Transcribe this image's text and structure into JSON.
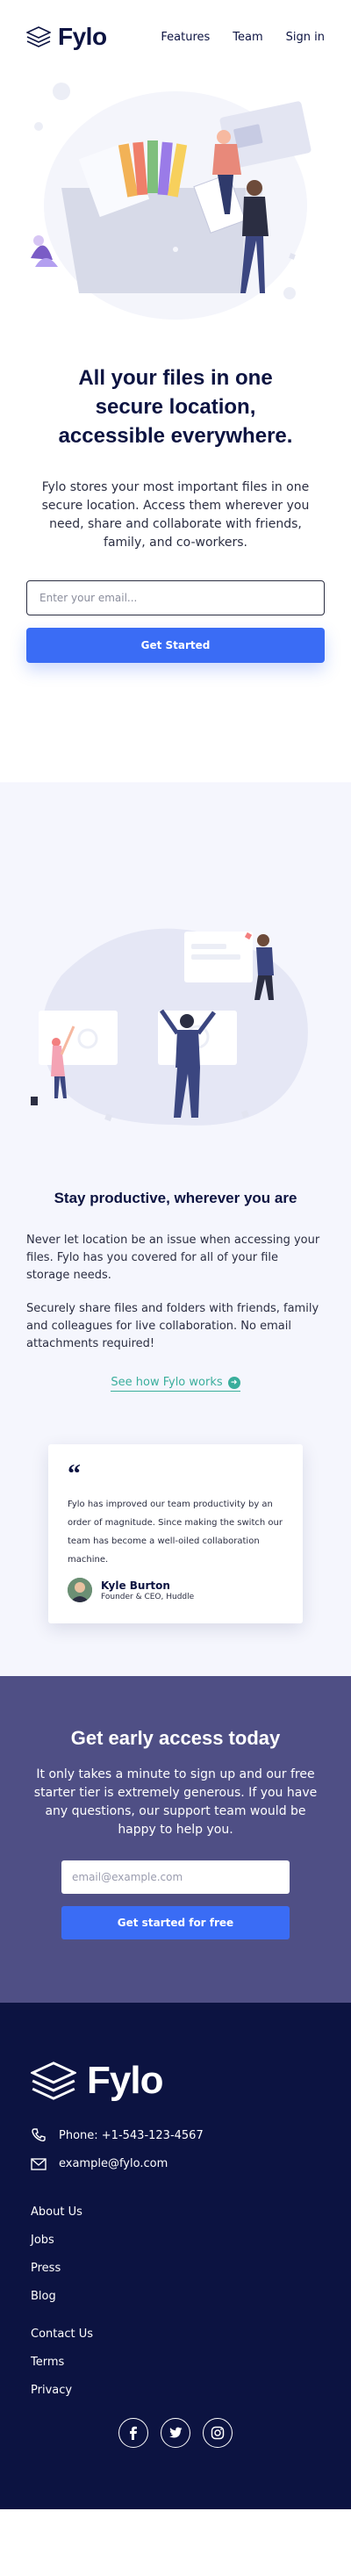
{
  "header": {
    "brand": "Fylo",
    "nav": [
      "Features",
      "Team",
      "Sign in"
    ]
  },
  "hero": {
    "title": "All your files in one secure location, accessible everywhere.",
    "description": "Fylo stores your most important files in one secure location. Access them wherever you need, share and collaborate with friends, family, and co-workers.",
    "email_placeholder": "Enter your email...",
    "cta_label": "Get Started"
  },
  "productive": {
    "title": "Stay productive, wherever you are",
    "paragraph_1": "Never let location be an issue when accessing your files. Fylo has you covered for all of your file storage needs.",
    "paragraph_2": "Securely share files and folders with friends, family and colleagues for live collaboration. No email attachments required!",
    "link_label": "See how Fylo works"
  },
  "testimonial": {
    "quote": "Fylo has improved our team productivity by an order of magnitude. Since making the switch our team has become a well-oiled collaboration machine.",
    "name": "Kyle Burton",
    "role": "Founder & CEO, Huddle"
  },
  "early_access": {
    "title": "Get early access today",
    "description": "It only takes a minute to sign up and our free starter tier is extremely generous. If you have any questions, our support team would be happy to help you.",
    "email_placeholder": "email@example.com",
    "cta_label": "Get started for free"
  },
  "footer": {
    "brand": "Fylo",
    "phone": "Phone: +1-543-123-4567",
    "email": "example@fylo.com",
    "links_1": [
      "About Us",
      "Jobs",
      "Press",
      "Blog"
    ],
    "links_2": [
      "Contact Us",
      "Terms",
      "Privacy"
    ],
    "socials": [
      "facebook-icon",
      "twitter-icon",
      "instagram-icon"
    ]
  },
  "colors": {
    "brand_navy": "#0c1341",
    "primary_blue": "#3a6cf5",
    "accent_teal": "#3aae9c",
    "early_bg": "#4f4f85",
    "section_bg": "#f5f6fd"
  }
}
